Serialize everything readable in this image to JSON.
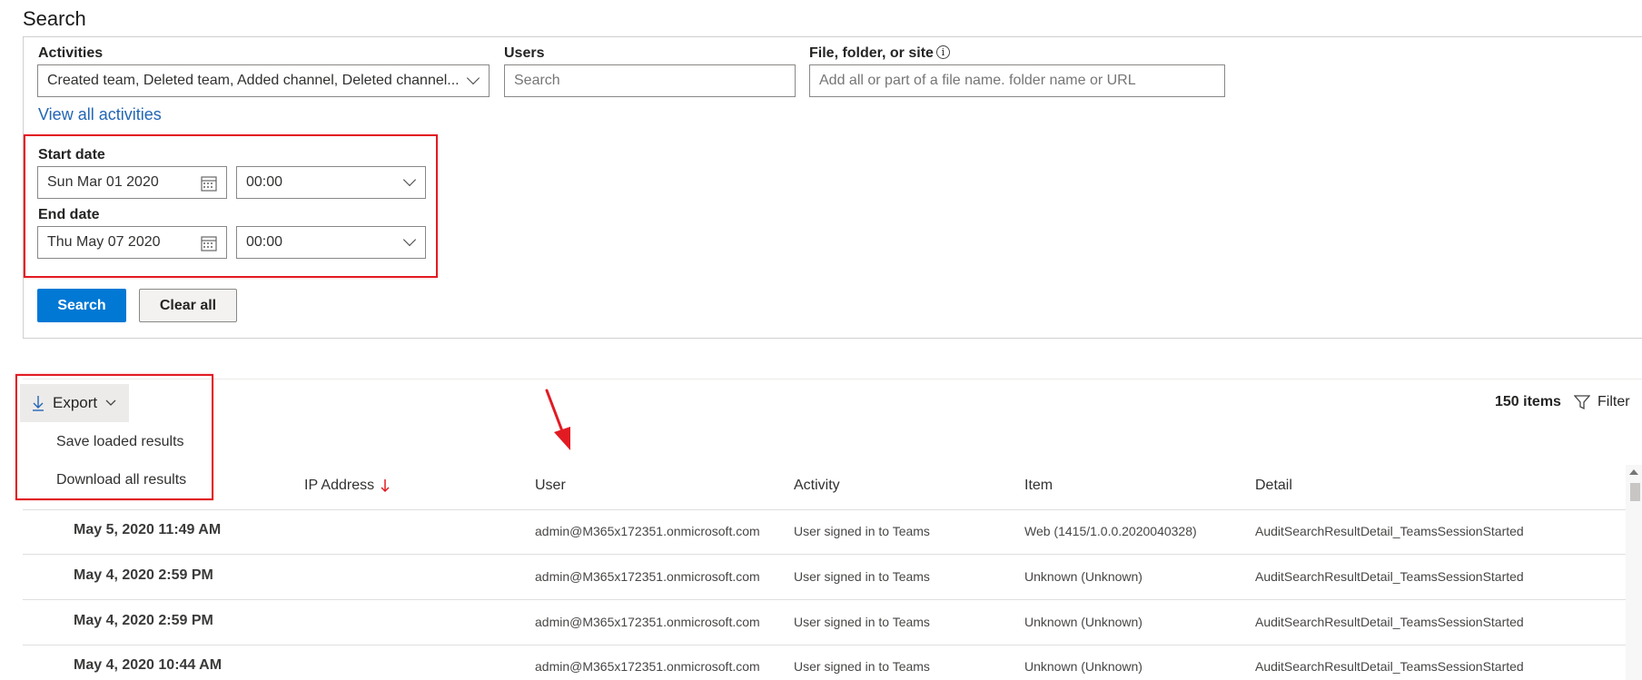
{
  "page": {
    "title": "Search"
  },
  "filters": {
    "activities_label": "Activities",
    "activities_value": "Created team, Deleted team, Added channel, Deleted channel...",
    "users_label": "Users",
    "users_placeholder": "Search",
    "file_label": "File, folder, or site",
    "file_placeholder": "Add all or part of a file name. folder name or URL",
    "view_all_link": "View all activities",
    "start_date_label": "Start date",
    "start_date_value": "Sun Mar 01 2020",
    "start_time_value": "00:00",
    "end_date_label": "End date",
    "end_date_value": "Thu May 07 2020",
    "end_time_value": "00:00",
    "search_button": "Search",
    "clear_button": "Clear all"
  },
  "commandbar": {
    "export_label": "Export",
    "export_menu": [
      "Save loaded results",
      "Download all results"
    ],
    "item_count": "150 items",
    "filter_label": "Filter"
  },
  "table": {
    "headers": {
      "ip": "IP Address",
      "user": "User",
      "activity": "Activity",
      "item": "Item",
      "detail": "Detail"
    },
    "rows": [
      {
        "date": "May 5, 2020 11:49 AM",
        "user": "admin@M365x172351.onmicrosoft.com",
        "activity": "User signed in to Teams",
        "item": "Web (1415/1.0.0.2020040328)",
        "detail": "AuditSearchResultDetail_TeamsSessionStarted"
      },
      {
        "date": "May 4, 2020 2:59 PM",
        "user": "admin@M365x172351.onmicrosoft.com",
        "activity": "User signed in to Teams",
        "item": "Unknown (Unknown)",
        "detail": "AuditSearchResultDetail_TeamsSessionStarted"
      },
      {
        "date": "May 4, 2020 2:59 PM",
        "user": "admin@M365x172351.onmicrosoft.com",
        "activity": "User signed in to Teams",
        "item": "Unknown (Unknown)",
        "detail": "AuditSearchResultDetail_TeamsSessionStarted"
      },
      {
        "date": "May 4, 2020 10:44 AM",
        "user": "admin@M365x172351.onmicrosoft.com",
        "activity": "User signed in to Teams",
        "item": "Unknown (Unknown)",
        "detail": "AuditSearchResultDetail_TeamsSessionStarted"
      }
    ]
  },
  "colors": {
    "primary": "#0078d4",
    "link": "#2266b5",
    "highlight": "#e21b23"
  }
}
